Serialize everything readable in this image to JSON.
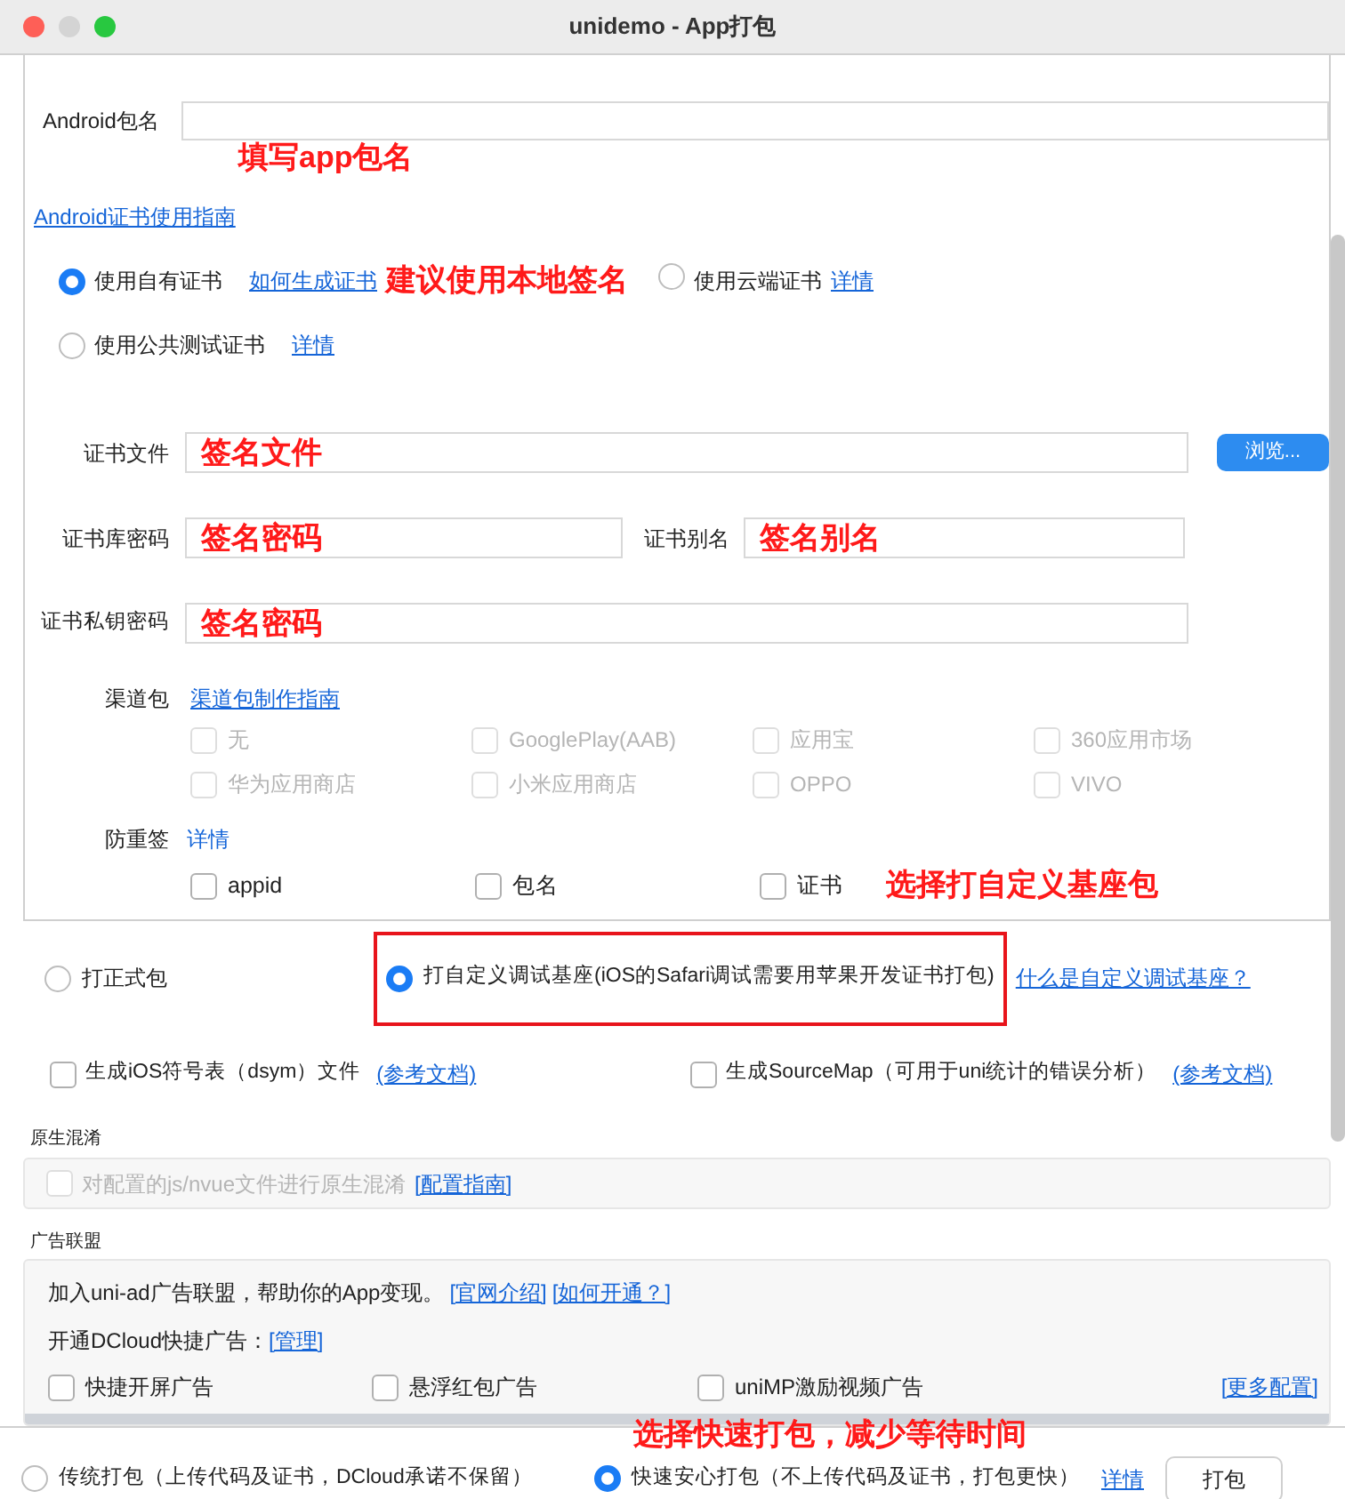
{
  "window": {
    "title": "unidemo - App打包"
  },
  "android_package": {
    "label": "Android包名",
    "annotation": "填写app包名"
  },
  "cert_guide_link": "Android证书使用指南",
  "cert_options": [
    {
      "label": "使用自有证书",
      "selected": true,
      "link": "如何生成证书",
      "annotation": "建议使用本地签名"
    },
    {
      "label": "使用云端证书",
      "selected": false,
      "link": "详情"
    },
    {
      "label": "使用公共测试证书",
      "selected": false,
      "link": "详情"
    }
  ],
  "cert_file": {
    "label": "证书文件",
    "annotation": "签名文件",
    "button": "浏览..."
  },
  "keystore_password": {
    "label": "证书库密码",
    "annotation": "签名密码"
  },
  "cert_alias": {
    "label": "证书别名",
    "annotation": "签名别名"
  },
  "private_key_password": {
    "label": "证书私钥密码",
    "annotation": "签名密码"
  },
  "channels": {
    "label": "渠道包",
    "link": "渠道包制作指南",
    "items": [
      {
        "label": "无",
        "checked": false,
        "disabled": true
      },
      {
        "label": "GooglePlay(AAB)",
        "checked": false,
        "disabled": true
      },
      {
        "label": "应用宝",
        "checked": false,
        "disabled": true
      },
      {
        "label": "360应用市场",
        "checked": false,
        "disabled": true
      },
      {
        "label": "华为应用商店",
        "checked": false,
        "disabled": true
      },
      {
        "label": "小米应用商店",
        "checked": false,
        "disabled": true
      },
      {
        "label": "OPPO",
        "checked": false,
        "disabled": true
      },
      {
        "label": "VIVO",
        "checked": false,
        "disabled": true
      }
    ]
  },
  "anti_resign": {
    "label": "防重签",
    "link": "详情",
    "annotation": "选择打自定义基座包",
    "items": [
      {
        "label": "appid",
        "checked": false
      },
      {
        "label": "包名",
        "checked": false
      },
      {
        "label": "证书",
        "checked": false
      }
    ]
  },
  "package_type": {
    "options": [
      {
        "label": "打正式包",
        "selected": false
      },
      {
        "label": "打自定义调试基座(iOS的Safari调试需要用苹果开发证书打包)",
        "selected": true,
        "highlighted": true
      }
    ],
    "link": "什么是自定义调试基座？"
  },
  "extra_options": [
    {
      "label": "生成iOS符号表（dsym）文件",
      "link": "(参考文档)",
      "checked": false
    },
    {
      "label": "生成SourceMap（可用于uni统计的错误分析）",
      "link": "(参考文档)",
      "checked": false
    }
  ],
  "native_obfuscation": {
    "title": "原生混淆",
    "option": {
      "label": "对配置的js/nvue文件进行原生混淆",
      "checked": false,
      "disabled": true
    },
    "link": "[配置指南]"
  },
  "ad_alliance": {
    "title": "广告联盟",
    "intro": "加入uni-ad广告联盟，帮助你的App变现。",
    "links": [
      "[官网介绍]",
      "[如何开通？]"
    ],
    "quick_label": "开通DCloud快捷广告：",
    "quick_link": "[管理]",
    "items": [
      {
        "label": "快捷开屏广告",
        "checked": false
      },
      {
        "label": "悬浮红包广告",
        "checked": false
      },
      {
        "label": "uniMP激励视频广告",
        "checked": false
      }
    ],
    "more_link": "[更多配置]"
  },
  "footer": {
    "annotation": "选择快速打包，减少等待时间",
    "modes": [
      {
        "label": "传统打包（上传代码及证书，DCloud承诺不保留）",
        "selected": false
      },
      {
        "label": "快速安心打包（不上传代码及证书，打包更快）",
        "selected": true
      }
    ],
    "link": "详情",
    "button": "打包"
  }
}
